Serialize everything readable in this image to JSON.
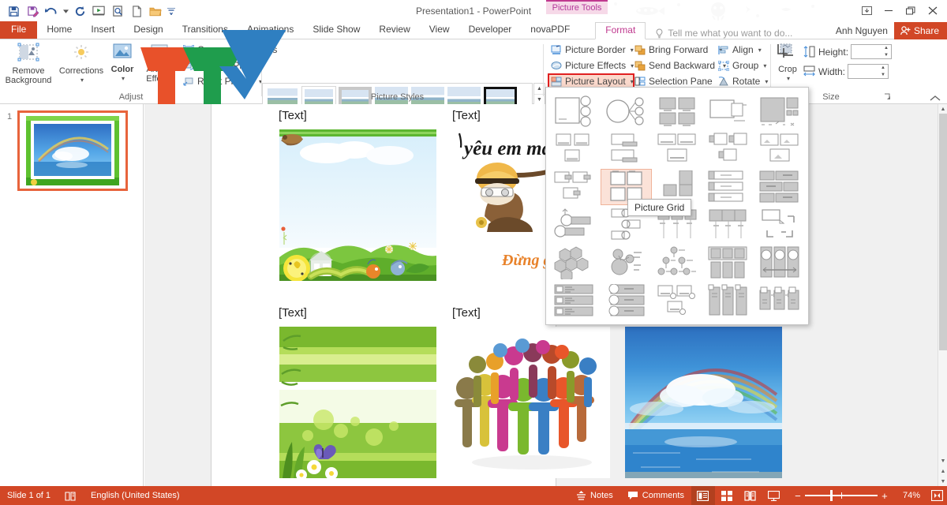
{
  "window": {
    "title": "Presentation1 - PowerPoint",
    "contextual_tab_group": "Picture Tools",
    "quick_access": [
      {
        "name": "save-icon",
        "label": "Save"
      },
      {
        "name": "save-as-icon",
        "label": "Save As"
      },
      {
        "name": "undo-icon",
        "label": "Undo"
      },
      {
        "name": "redo-icon",
        "label": "Redo"
      },
      {
        "name": "start-slideshow-icon",
        "label": "Start From Beginning"
      },
      {
        "name": "print-preview-icon",
        "label": "Print Preview and Print"
      },
      {
        "name": "new-icon",
        "label": "New"
      },
      {
        "name": "open-icon",
        "label": "Open"
      },
      {
        "name": "customize-qat-icon",
        "label": "Customize Quick Access Toolbar"
      }
    ],
    "controls": {
      "ribbon_display": "Ribbon Display Options",
      "minimize": "Minimize",
      "restore": "Restore Down",
      "close": "Close"
    }
  },
  "tabs": [
    {
      "label": "File",
      "active": false,
      "file": true
    },
    {
      "label": "Home",
      "active": false
    },
    {
      "label": "Insert",
      "active": false
    },
    {
      "label": "Design",
      "active": false
    },
    {
      "label": "Transitions",
      "active": false
    },
    {
      "label": "Animations",
      "active": false
    },
    {
      "label": "Slide Show",
      "active": false
    },
    {
      "label": "Review",
      "active": false
    },
    {
      "label": "View",
      "active": false
    },
    {
      "label": "Developer",
      "active": false
    },
    {
      "label": "novaPDF",
      "active": false
    },
    {
      "label": "Format",
      "active": true
    }
  ],
  "tell_me": {
    "placeholder": "Tell me what you want to do...",
    "icon": "lightbulb-icon"
  },
  "account": {
    "user": "Anh Nguyen",
    "share_label": "Share"
  },
  "ribbon": {
    "groups": [
      {
        "name": "Adjust",
        "title": "Adjust",
        "big_buttons": [
          {
            "label": "Remove\nBackground",
            "line1": "Remove",
            "line2": "Background",
            "icon": "remove-background-icon"
          },
          {
            "label": "Corrections",
            "line1": "Corrections",
            "line2": "",
            "icon": "corrections-icon",
            "has_caret": true
          },
          {
            "label": "Color",
            "line1": "Color",
            "line2": "",
            "icon": "color-icon",
            "has_caret": true
          },
          {
            "label": "Artistic Effects",
            "line1": "Artistic",
            "line2": "Effects",
            "icon": "artistic-effects-icon",
            "has_caret": true
          }
        ],
        "small_buttons": [
          {
            "label": "Compress Pictures",
            "icon": "compress-pictures-icon"
          },
          {
            "label": "Change Picture",
            "icon": "change-picture-icon"
          },
          {
            "label": "Reset Picture",
            "icon": "reset-picture-icon",
            "has_caret": true
          }
        ]
      },
      {
        "name": "Picture Styles",
        "title": "Picture Styles",
        "gallery_count": 7,
        "selected_index": 6,
        "scroll": [
          "up",
          "down",
          "more"
        ]
      },
      {
        "name": "Arrange",
        "title": "",
        "small_buttons": [
          {
            "label": "Picture Border",
            "icon": "picture-border-icon",
            "has_caret": true
          },
          {
            "label": "Picture Effects",
            "icon": "picture-effects-icon",
            "has_caret": true
          },
          {
            "label": "Picture Layout",
            "icon": "picture-layout-icon",
            "has_caret": true,
            "highlighted": true
          },
          {
            "label": "Bring Forward",
            "icon": "bring-forward-icon",
            "has_caret": true
          },
          {
            "label": "Send Backward",
            "icon": "send-backward-icon",
            "has_caret": true
          },
          {
            "label": "Selection Pane",
            "icon": "selection-pane-icon"
          },
          {
            "label": "Align",
            "icon": "align-icon",
            "has_caret": true
          },
          {
            "label": "Group",
            "icon": "group-icon",
            "has_caret": true
          },
          {
            "label": "Rotate",
            "icon": "rotate-icon",
            "has_caret": true
          }
        ]
      },
      {
        "name": "Size",
        "title": "Size",
        "crop_label": "Crop",
        "crop_icon": "crop-icon",
        "height_label": "Height:",
        "height_value": "",
        "width_label": "Width:",
        "width_value": "",
        "dialog_launcher": "size-dialog-launcher"
      }
    ],
    "collapse_icon": "collapse-ribbon-icon"
  },
  "picture_layout_gallery": {
    "open": true,
    "tooltip": "Picture Grid",
    "selected_item_row": 2,
    "selected_item_col": 1,
    "rows": 6,
    "cols": 5,
    "items": [
      [
        "accented-picture",
        "circle-picture-hierarchy",
        "picture-grid-1",
        "picture-caption-list",
        "picture-strips"
      ],
      [
        "captioned-pictures",
        "picture-caption",
        "bending-picture-caption",
        "bubble-picture-list",
        "picture-accent-list"
      ],
      [
        "snapshot-picture-list",
        "picture-grid",
        "picture-lineup",
        "vertical-picture-list",
        "alternating-picture-blocks"
      ],
      [
        "ascending-picture-accent",
        "continuous-picture-list",
        "titled-picture-blocks",
        "picture-strips-2",
        "framed-text-picture"
      ],
      [
        "hexagon-cluster",
        "radial-picture-list",
        "hierarchy-picture-list",
        "picture-frame-grid",
        "circular-picture-callout"
      ],
      [
        "vertical-picture-accent-list",
        "horizontal-picture-list",
        "bending-picture-blocks",
        "vertical-block-list",
        "linked-picture-blocks"
      ]
    ]
  },
  "slide_panel": {
    "slides": [
      {
        "number": "1",
        "selected": true
      }
    ]
  },
  "slide": {
    "cells": [
      {
        "label": "[Text]",
        "image": "nature-caterpillar-house"
      },
      {
        "label": "[Text]",
        "image": "vietnamese-calligraphy-fishing"
      },
      {
        "label": "[Text]",
        "image": "green-bamboo-butterfly"
      },
      {
        "label": "[Text]",
        "image": "colorful-people-circle"
      }
    ],
    "extra_image": "rainbow-over-ocean"
  },
  "status_bar": {
    "slide_count": "Slide 1 of 1",
    "accessibility_icon": "notes-page-icon",
    "language": "English (United States)",
    "notes_label": "Notes",
    "notes_icon": "notes-icon",
    "comments_label": "Comments",
    "comments_icon": "comments-icon",
    "views": [
      {
        "name": "normal-view-button",
        "active": true
      },
      {
        "name": "slide-sorter-view-button",
        "active": false
      },
      {
        "name": "reading-view-button",
        "active": false
      },
      {
        "name": "slideshow-view-button",
        "active": false
      }
    ],
    "zoom_out": "−",
    "zoom_in": "+",
    "zoom_level": "74%",
    "fit_slide_icon": "fit-slide-to-window-icon"
  },
  "colors": {
    "powerpoint_orange": "#d24726",
    "contextual_pink": "#c0398f",
    "highlight_red": "#e02020",
    "selection_orange": "#e8643c"
  }
}
